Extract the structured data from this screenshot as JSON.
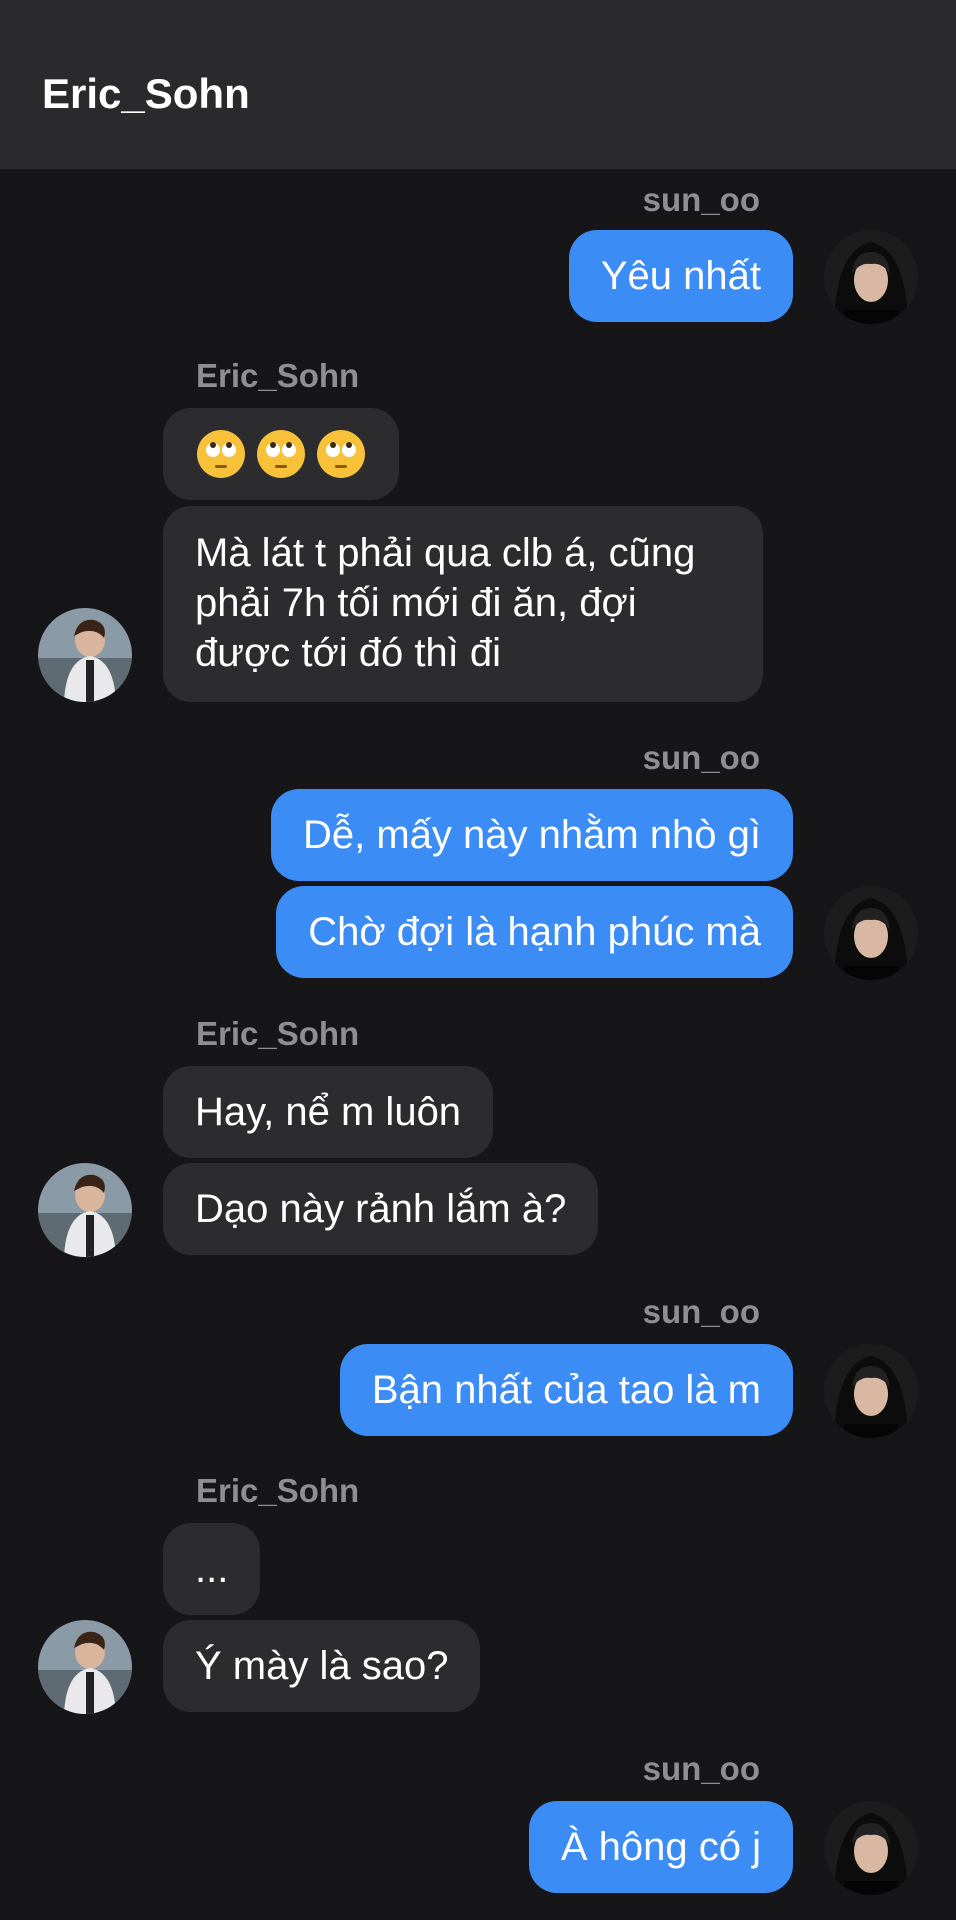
{
  "header": {
    "title": "Eric_Sohn"
  },
  "names": {
    "me": "sun_oo",
    "other": "Eric_Sohn"
  },
  "messages": [
    {
      "text": "Yêu nhất"
    },
    {
      "text": ""
    },
    {
      "text": "Mà lát t phải qua clb á, cũng phải 7h tối mới đi ăn, đợi được tới đó thì đi"
    },
    {
      "text": "Dễ, mấy này nhằm nhò gì"
    },
    {
      "text": "Chờ đợi là hạnh phúc mà"
    },
    {
      "text": "Hay, nể m luôn"
    },
    {
      "text": "Dạo này rảnh lắm à?"
    },
    {
      "text": "Bận nhất của tao là m"
    },
    {
      "text": "..."
    },
    {
      "text": "Ý mày là sao?"
    },
    {
      "text": "À hông có j"
    }
  ],
  "colors": {
    "background": "#161618",
    "header": "#2a2a2c",
    "outgoing_bubble": "#3b8cf5",
    "incoming_bubble": "#2c2c2e",
    "sender_name": "#8e8e93"
  },
  "icons": {
    "emoji": "face-with-rolling-eyes-emoji",
    "avatar_me": "avatar-photo-hooded",
    "avatar_other": "avatar-photo-outdoor"
  }
}
